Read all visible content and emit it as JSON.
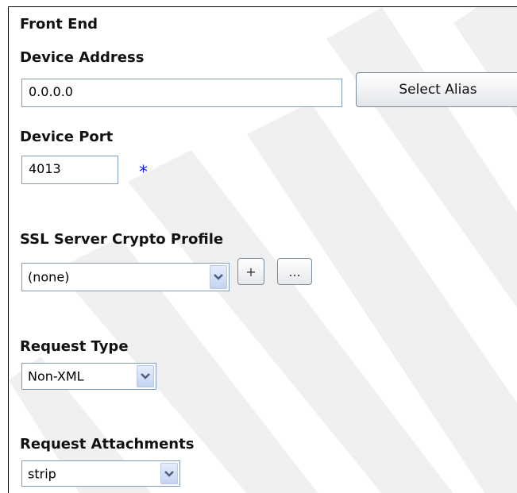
{
  "form": {
    "section_title": "Front End",
    "device_address": {
      "label": "Device Address",
      "value": "0.0.0.0",
      "alias_button": "Select Alias"
    },
    "device_port": {
      "label": "Device Port",
      "value": "4013",
      "required_marker": "*"
    },
    "ssl_profile": {
      "label": "SSL Server Crypto Profile",
      "selected": "(none)",
      "add_button": "+",
      "edit_button": "..."
    },
    "request_type": {
      "label": "Request Type",
      "selected": "Non-XML"
    },
    "request_attachments": {
      "label": "Request Attachments",
      "selected": "strip"
    }
  },
  "colors": {
    "input_border": "#7f9db9",
    "required_marker": "#1a1aff"
  },
  "icons": {
    "dropdown": "chevron-down-icon"
  }
}
